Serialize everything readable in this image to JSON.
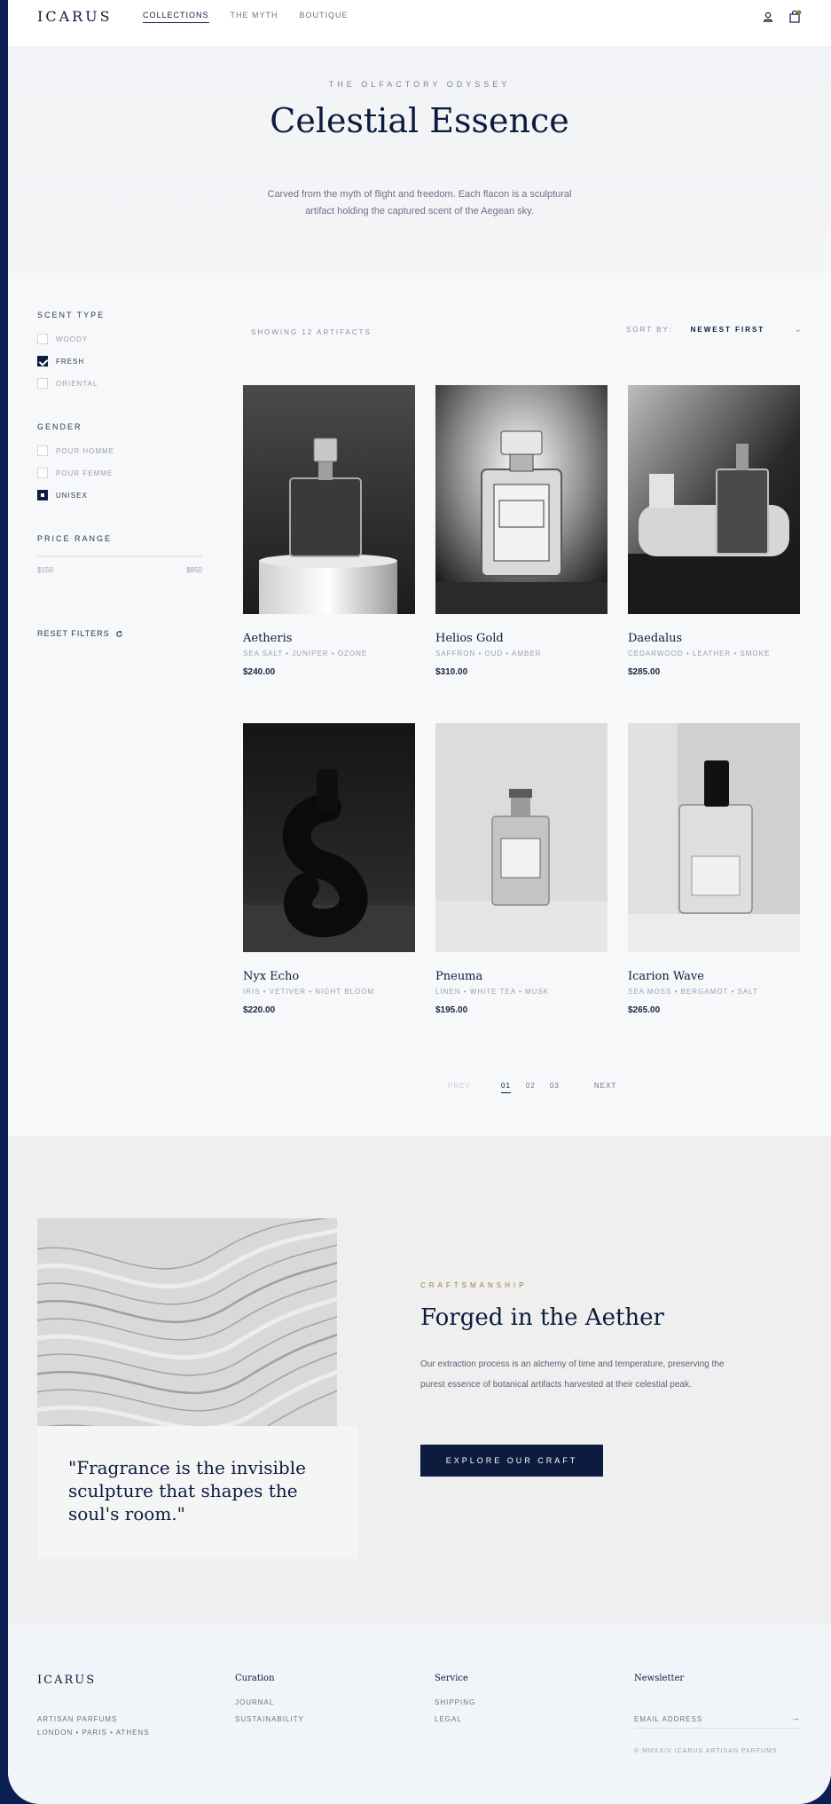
{
  "header": {
    "logo": "ICARUS",
    "nav": [
      "COLLECTIONS",
      "THE MYTH",
      "BOUTIQUE"
    ],
    "icons": [
      "user-icon",
      "bag-icon"
    ]
  },
  "hero": {
    "eyebrow": "THE OLFACTORY ODYSSEY",
    "title": "Celestial Essence",
    "description": "Carved from the myth of flight and freedom. Each flacon is a sculptural artifact holding the captured scent of the Aegean sky."
  },
  "filters": {
    "scent_title": "SCENT TYPE",
    "scent": [
      {
        "label": "WOODY",
        "checked": false
      },
      {
        "label": "FRESH",
        "checked": true
      },
      {
        "label": "ORIENTAL",
        "checked": false
      }
    ],
    "gender_title": "GENDER",
    "gender": [
      {
        "label": "POUR HOMME",
        "checked": false
      },
      {
        "label": "POUR FEMME",
        "checked": false
      },
      {
        "label": "UNISEX",
        "checked": true
      }
    ],
    "price_title": "PRICE RANGE",
    "price_min": "$150",
    "price_max": "$850",
    "reset": "RESET FILTERS"
  },
  "grid": {
    "showing": "SHOWING 12 ARTIFACTS",
    "sort_label": "SORT BY:",
    "sort_value": "NEWEST FIRST"
  },
  "products": [
    {
      "name": "Aetheris",
      "notes": "SEA SALT • JUNIPER • OZONE",
      "price": "$240.00"
    },
    {
      "name": "Helios Gold",
      "notes": "SAFFRON • OUD • AMBER",
      "price": "$310.00"
    },
    {
      "name": "Daedalus",
      "notes": "CEDARWOOD • LEATHER • SMOKE",
      "price": "$285.00"
    },
    {
      "name": "Nyx Echo",
      "notes": "IRIS • VETIVER • NIGHT BLOOM",
      "price": "$220.00"
    },
    {
      "name": "Pneuma",
      "notes": "LINEN • WHITE TEA • MUSK",
      "price": "$195.00"
    },
    {
      "name": "Icarion Wave",
      "notes": "SEA MOSS • BERGAMOT • SALT",
      "price": "$265.00"
    }
  ],
  "pagination": {
    "prev": "PREV",
    "pages": [
      "01",
      "02",
      "03"
    ],
    "current": "01",
    "next": "NEXT"
  },
  "craft": {
    "quote": "\"Fragrance is the invisible sculpture that shapes the soul's room.\"",
    "eyebrow": "CRAFTSMANSHIP",
    "title": "Forged in the Aether",
    "body": "Our extraction process is an alchemy of time and temperature, preserving the purest essence of botanical artifacts harvested at their celestial peak.",
    "cta": "EXPLORE OUR CRAFT"
  },
  "footer": {
    "logo": "ICARUS",
    "tagline1": "ARTISAN PARFUMS",
    "tagline2": "LONDON • PARIS • ATHENS",
    "col1_title": "Curation",
    "col1_links": [
      "JOURNAL",
      "SUSTAINABILITY"
    ],
    "col2_title": "Service",
    "col2_links": [
      "SHIPPING",
      "LEGAL"
    ],
    "newsletter_title": "Newsletter",
    "newsletter_placeholder": "EMAIL ADDRESS",
    "copyright": "© MMXXIV ICARUS ARTISAN PARFUMS"
  },
  "colors": {
    "navy": "#0d1b3e",
    "background": "#f7f8fa",
    "gold": "#9a7a3a",
    "outer_frame": "#0a1f52"
  }
}
